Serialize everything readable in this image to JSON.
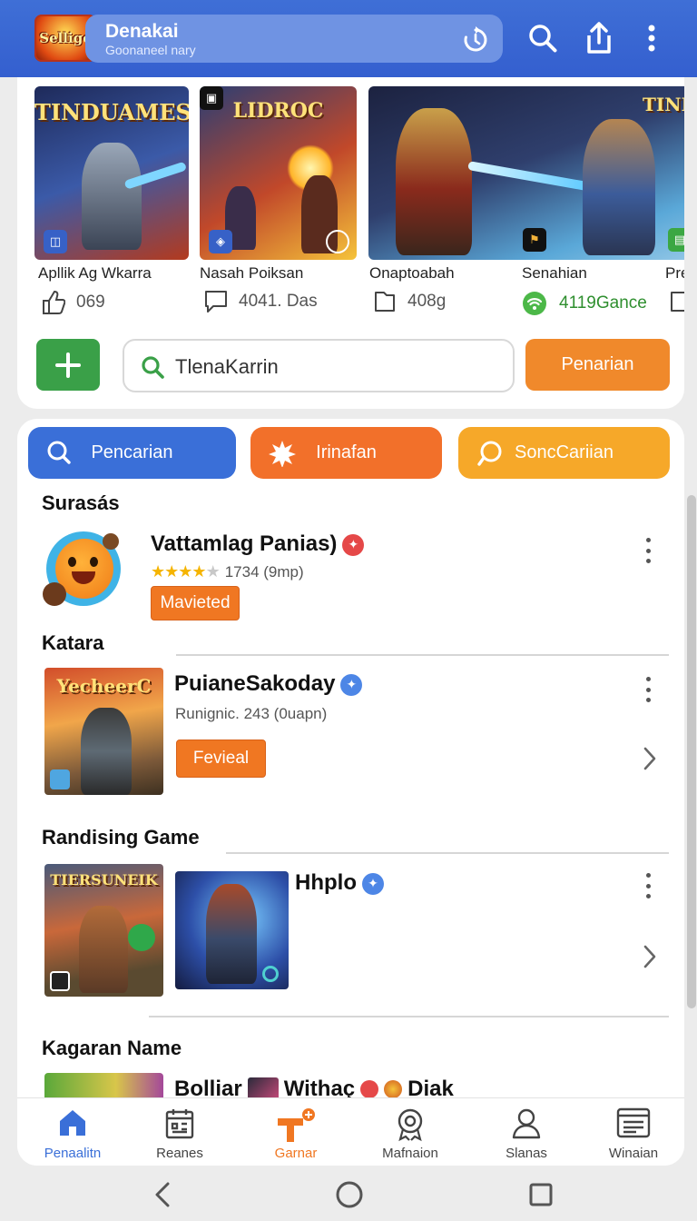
{
  "header": {
    "logo_text": "Sellige",
    "title": "Denakai",
    "subtitle": "Goonaneel nary",
    "icons": [
      "refresh-icon",
      "search-icon",
      "share-icon",
      "more-vert-icon"
    ]
  },
  "featured": {
    "items": [
      {
        "art_title": "TINDUAMESA",
        "name": "Apllik Ag Wkarra",
        "stat": "069",
        "stat_icon": "thumb-icon"
      },
      {
        "art_title": "LIDROC",
        "name": "Nasah Poiksan",
        "stat": "4041. Das",
        "stat_icon": "chat-icon"
      },
      {
        "art_title": "",
        "name": "Onaptoabah",
        "stat": "408g",
        "stat_icon": "file-icon"
      },
      {
        "art_title": "TINDIAS",
        "name": "Senahian",
        "stat": "4119Gance",
        "stat_icon": "wifi-icon"
      },
      {
        "art_title": "",
        "name": "Pree",
        "stat": "",
        "stat_icon": "file-icon"
      }
    ],
    "add_button_icon": "plus-icon",
    "search_value": "TlenaKarrin",
    "action_label": "Penarian"
  },
  "chips": [
    {
      "label": "Pencarian",
      "icon": "search-icon",
      "color": "#3a6fd8"
    },
    {
      "label": "Irinafan",
      "icon": "burst-icon",
      "color": "#f2702a"
    },
    {
      "label": "SoncCariian",
      "icon": "chat-search-icon",
      "color": "#f6a829"
    }
  ],
  "sections": {
    "s1": {
      "title": "Surasás",
      "app_name": "Vattamlag Panias)",
      "rating_text": "1734 (9mp)",
      "rating": 4,
      "tag": "Mavieted"
    },
    "s2": {
      "title": "Katara",
      "app_name": "PuianeSakoday",
      "subtitle": "Runignic. 243 (0uapn)",
      "tag": "Fevieal",
      "art_title": "YecheerC"
    },
    "s3": {
      "title": "Randising Game",
      "app_name": "Hhplo",
      "art_title": "TIERSUNEIK"
    },
    "s4": {
      "title": "Kagaran Name",
      "partial_text_1": "Bolliar",
      "partial_text_2": "Withaç",
      "partial_text_3": "Diak"
    }
  },
  "bottom_nav": [
    {
      "label": "Penaalitn",
      "icon": "home-icon",
      "active": true
    },
    {
      "label": "Reanes",
      "icon": "calendar-icon",
      "active": false
    },
    {
      "label": "Garnar",
      "icon": "hammer-icon",
      "active": false,
      "accent": true
    },
    {
      "label": "Mafnaion",
      "icon": "award-icon",
      "active": false
    },
    {
      "label": "Slanas",
      "icon": "person-icon",
      "active": false
    },
    {
      "label": "Winaian",
      "icon": "list-icon",
      "active": false
    }
  ],
  "colors": {
    "header": "#3f6fd6",
    "green": "#3aa048",
    "orange": "#f0892b",
    "nav_active": "#3a6fd8"
  }
}
